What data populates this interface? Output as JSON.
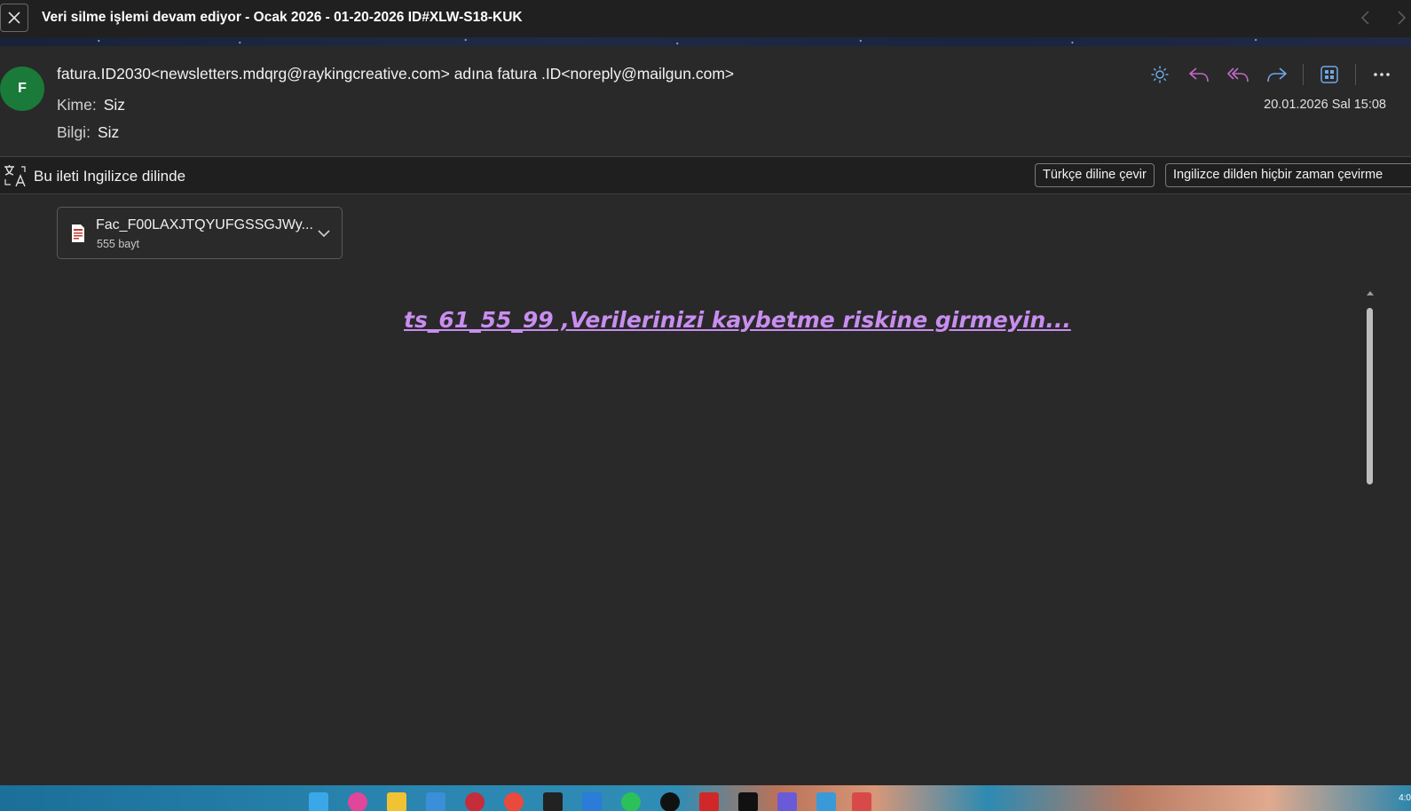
{
  "window": {
    "title": "Veri silme işlemi devam ediyor - Ocak 2026 - 01-20-2026  ID#XLW-S18-KUK"
  },
  "message": {
    "avatar_letter": "F",
    "from": "fatura.ID2030<newsletters.mdqrg@raykingcreative.com> adına fatura .ID<noreply@mailgun.com>",
    "to_label": "Kime:",
    "to_value": "Siz",
    "cc_label": "Bilgi:",
    "cc_value": "Siz",
    "date": "20.01.2026 Sal 15:08"
  },
  "actions": {
    "icons": [
      "sun-icon",
      "reply-icon",
      "reply-all-icon",
      "forward-icon",
      "apps-icon",
      "more-icon"
    ]
  },
  "translation_bar": {
    "text": "Bu ileti Ingilizce dilinde",
    "translate_button": "Türkçe diline çevir",
    "never_button": "Ingilizce dilden hiçbir zaman çevirme"
  },
  "attachment": {
    "name": "Fac_F00LAXJTQYUFGSSGJWy...",
    "size": "555 bayt"
  },
  "body": {
    "link_text": "ts_61_55_99 ,Verilerinizi kaybetme riskine girmeyin..."
  },
  "taskbar": {
    "clock": "4:0"
  },
  "colors": {
    "accent_blue": "#6fa8e6",
    "accent_purple": "#c06ac8",
    "link": "#c98ef0",
    "avatar": "#1a7a3a"
  }
}
